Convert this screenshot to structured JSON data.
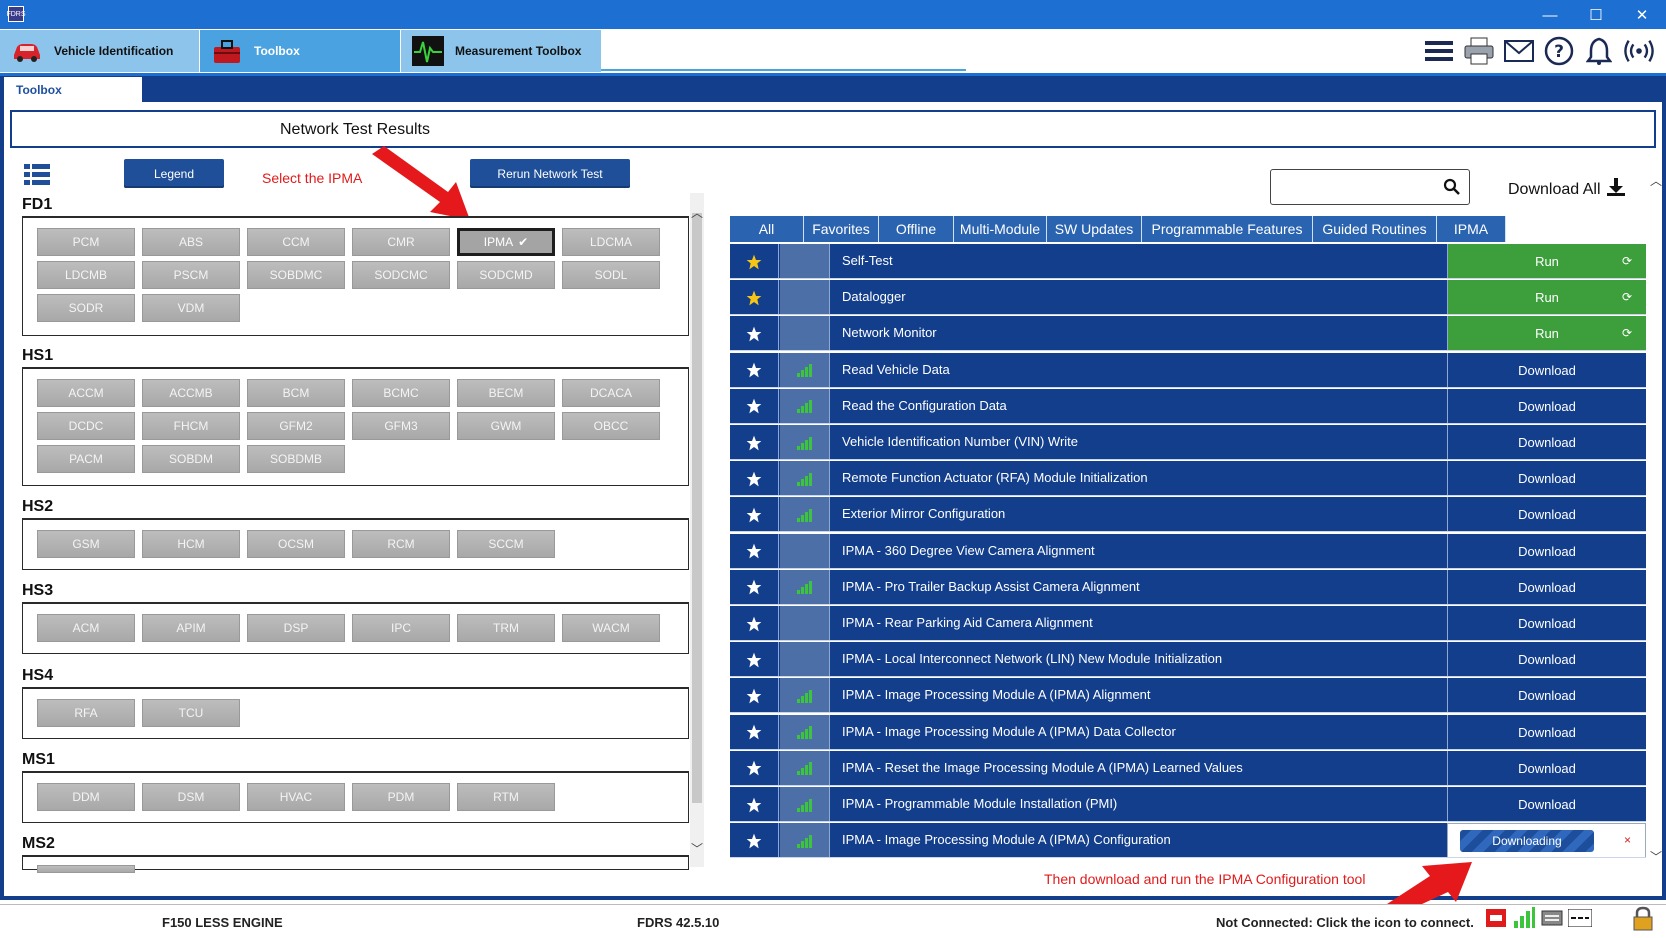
{
  "titlebar": {
    "app_icon_text": "FDRS",
    "minimize": "—",
    "maximize": "☐",
    "close": "✕"
  },
  "app_tabs": [
    {
      "label": "Vehicle Identification",
      "icon": "car-icon"
    },
    {
      "label": "Toolbox",
      "icon": "toolbox-icon"
    },
    {
      "label": "Measurement Toolbox",
      "icon": "oscilloscope-icon"
    }
  ],
  "toolbar_icons": [
    "menu-icon",
    "printer-icon",
    "mail-icon",
    "help-icon",
    "bell-icon",
    "wireless-icon"
  ],
  "sub_tab": {
    "label": "Toolbox"
  },
  "header": {
    "title": "Network Test Results"
  },
  "left": {
    "legend_button": "Legend",
    "rerun_button": "Rerun Network Test",
    "annotation": "Select the IPMA",
    "selected_module": "IPMA",
    "selected_check": "✔",
    "groups": [
      {
        "label": "FD1",
        "modules": [
          "PCM",
          "ABS",
          "CCM",
          "CMR",
          "IPMA",
          "LDCMA",
          "LDCMB",
          "PSCM",
          "SOBDMC",
          "SODCMC",
          "SODCMD",
          "SODL",
          "SODR",
          "VDM"
        ]
      },
      {
        "label": "HS1",
        "modules": [
          "ACCM",
          "ACCMB",
          "BCM",
          "BCMC",
          "BECM",
          "DCACA",
          "DCDC",
          "FHCM",
          "GFM2",
          "GFM3",
          "GWM",
          "OBCC",
          "PACM",
          "SOBDM",
          "SOBDMB"
        ]
      },
      {
        "label": "HS2",
        "modules": [
          "GSM",
          "HCM",
          "OCSM",
          "RCM",
          "SCCM"
        ]
      },
      {
        "label": "HS3",
        "modules": [
          "ACM",
          "APIM",
          "DSP",
          "IPC",
          "TRM",
          "WACM"
        ]
      },
      {
        "label": "HS4",
        "modules": [
          "RFA",
          "TCU"
        ]
      },
      {
        "label": "MS1",
        "modules": [
          "DDM",
          "DSM",
          "HVAC",
          "PDM",
          "RTM"
        ]
      },
      {
        "label": "MS2",
        "modules": []
      }
    ]
  },
  "right": {
    "search": {
      "value": "",
      "placeholder": ""
    },
    "download_all": "Download All",
    "filter_tabs": [
      "All",
      "Favorites",
      "Offline",
      "Multi-Module",
      "SW Updates",
      "Programmable Features",
      "Guided Routines",
      "IPMA"
    ],
    "rows": [
      {
        "name": "Self-Test",
        "action": "Run",
        "favorite": true,
        "signal": false,
        "state": "run"
      },
      {
        "name": "Datalogger",
        "action": "Run",
        "favorite": true,
        "signal": false,
        "state": "run"
      },
      {
        "name": "Network Monitor",
        "action": "Run",
        "favorite": false,
        "signal": false,
        "state": "run"
      },
      {
        "name": "Read Vehicle Data",
        "action": "Download",
        "favorite": false,
        "signal": true,
        "state": "download"
      },
      {
        "name": "Read the Configuration Data",
        "action": "Download",
        "favorite": false,
        "signal": true,
        "state": "download"
      },
      {
        "name": "Vehicle Identification Number (VIN) Write",
        "action": "Download",
        "favorite": false,
        "signal": true,
        "state": "download"
      },
      {
        "name": "Remote Function Actuator (RFA) Module Initialization",
        "action": "Download",
        "favorite": false,
        "signal": true,
        "state": "download"
      },
      {
        "name": "Exterior Mirror Configuration",
        "action": "Download",
        "favorite": false,
        "signal": true,
        "state": "download"
      },
      {
        "name": "IPMA - 360 Degree View Camera Alignment",
        "action": "Download",
        "favorite": false,
        "signal": false,
        "state": "download"
      },
      {
        "name": "IPMA - Pro Trailer Backup Assist Camera Alignment",
        "action": "Download",
        "favorite": false,
        "signal": true,
        "state": "download"
      },
      {
        "name": "IPMA - Rear Parking Aid Camera Alignment",
        "action": "Download",
        "favorite": false,
        "signal": false,
        "state": "download"
      },
      {
        "name": "IPMA - Local Interconnect Network (LIN) New Module Initialization",
        "action": "Download",
        "favorite": false,
        "signal": false,
        "state": "download"
      },
      {
        "name": "IPMA - Image Processing Module A (IPMA) Alignment",
        "action": "Download",
        "favorite": false,
        "signal": true,
        "state": "download"
      },
      {
        "name": "IPMA - Image Processing Module A (IPMA) Data Collector",
        "action": "Download",
        "favorite": false,
        "signal": true,
        "state": "download"
      },
      {
        "name": "IPMA - Reset the Image Processing Module A (IPMA) Learned Values",
        "action": "Download",
        "favorite": false,
        "signal": true,
        "state": "download"
      },
      {
        "name": "IPMA - Programmable Module Installation (PMI)",
        "action": "Download",
        "favorite": false,
        "signal": true,
        "state": "download"
      },
      {
        "name": "IPMA - Image Processing Module A (IPMA) Configuration",
        "action": "Downloading",
        "favorite": false,
        "signal": true,
        "state": "downloading"
      }
    ],
    "annotation": "Then download and run the IPMA Configuration tool",
    "cancel_glyph": "×",
    "refresh_glyph": "⟳"
  },
  "status": {
    "vehicle": "F150 LESS ENGINE",
    "version": "FDRS 42.5.10",
    "connection": "Not Connected: Click the icon to connect."
  },
  "colors": {
    "navy": "#123e8c",
    "tab_blue": "#2a63b0",
    "run_green": "#3c9f3c",
    "star_gold": "#f5c518",
    "signal_green": "#3cc43c",
    "annotation_red": "#e01b1b"
  }
}
